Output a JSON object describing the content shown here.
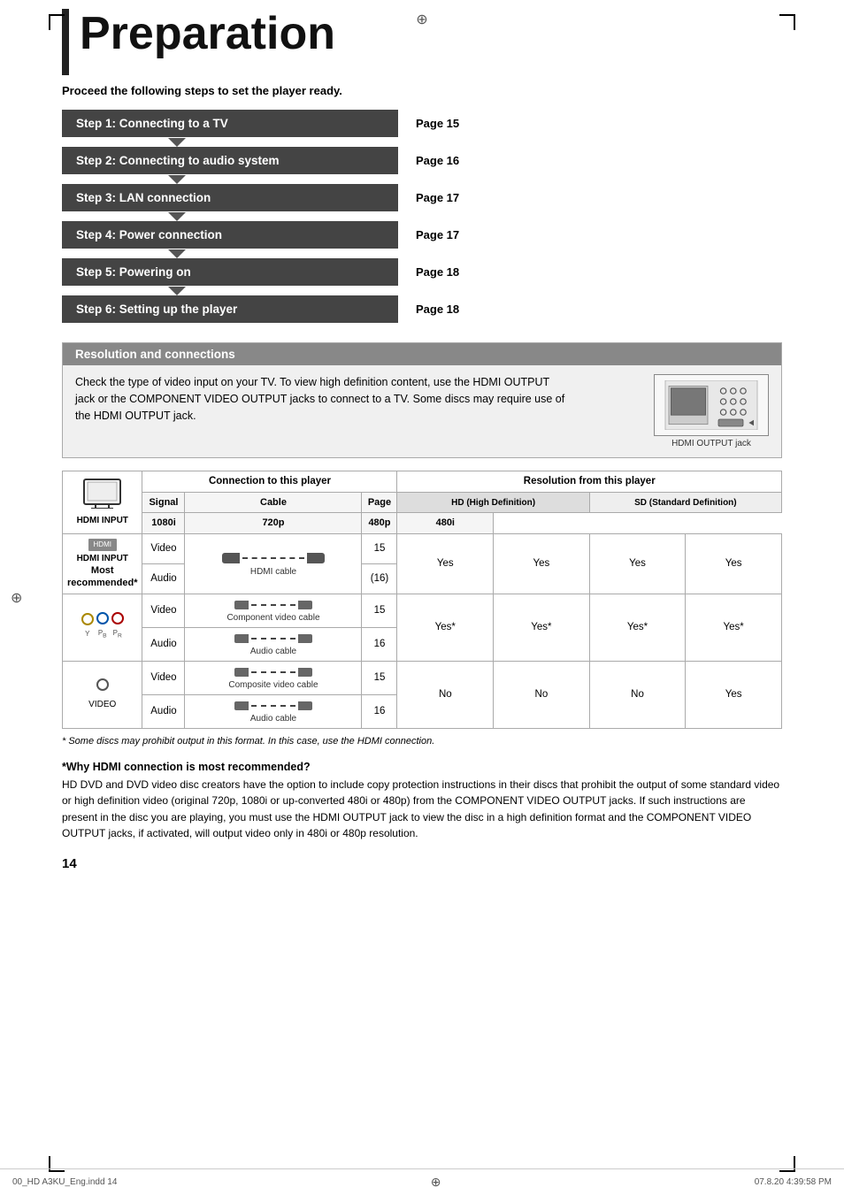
{
  "page": {
    "title": "Preparation",
    "subtitle": "Proceed the following steps to set the player ready.",
    "center_symbol": "⊕",
    "page_number": "14",
    "bottom_left": "00_HD A3KU_Eng.indd  14",
    "bottom_right": "07.8.20  4:39:58 PM"
  },
  "steps": [
    {
      "label": "Step 1: Connecting to a TV",
      "page": "Page 15",
      "has_arrow": true
    },
    {
      "label": "Step 2: Connecting to audio system",
      "page": "Page 16",
      "has_arrow": true
    },
    {
      "label": "Step 3: LAN connection",
      "page": "Page 17",
      "has_arrow": true
    },
    {
      "label": "Step 4: Power connection",
      "page": "Page 17",
      "has_arrow": true
    },
    {
      "label": "Step 5: Powering on",
      "page": "Page 18",
      "has_arrow": true
    },
    {
      "label": "Step 6: Setting up the player",
      "page": "Page 18",
      "has_arrow": false
    }
  ],
  "resolution_section": {
    "header": "Resolution and connections",
    "text": "Check the type of video input on your TV. To view high definition content, use the HDMI OUTPUT jack or the COMPONENT VIDEO OUTPUT jacks to connect to a TV. Some discs may require use of the HDMI OUTPUT jack.",
    "hdmi_label": "HDMI OUTPUT jack"
  },
  "table": {
    "connection_header": "Connection to this player",
    "resolution_header": "Resolution from this player",
    "hd_label": "HD (High Definition)",
    "sd_label": "SD (Standard Definition)",
    "cols": [
      "1080i",
      "720p",
      "480p",
      "480i"
    ],
    "col_signal": "Signal",
    "col_cable": "Cable",
    "col_page": "Page",
    "rows": [
      {
        "tv_type": "HDMI INPUT",
        "tv_note": "Most recommended*",
        "signal_rows": [
          "Video",
          "Audio"
        ],
        "cable_label": "HDMI cable",
        "page": [
          "15",
          "(16)"
        ],
        "values": [
          "Yes",
          "Yes",
          "Yes",
          "Yes"
        ]
      },
      {
        "tv_type": "Y PB PR",
        "tv_note": "",
        "signal_rows": [
          "Video",
          "Audio"
        ],
        "cable_label_video": "Component video cable",
        "cable_label_audio": "Audio cable",
        "page_video": "15",
        "page_audio": "16",
        "values": [
          "Yes*",
          "Yes*",
          "Yes*",
          "Yes*"
        ]
      },
      {
        "tv_type": "VIDEO",
        "tv_note": "",
        "signal_rows": [
          "Video",
          "Audio"
        ],
        "cable_label_video": "Composite video cable",
        "cable_label_audio": "Audio cable",
        "page_video": "15",
        "page_audio": "16",
        "values": [
          "No",
          "No",
          "No",
          "Yes"
        ]
      }
    ]
  },
  "footnote": "* Some discs may prohibit output in this format. In this case, use the HDMI connection.",
  "why_hdmi": {
    "title": "*Why HDMI connection is most recommended?",
    "text": "HD DVD and DVD video disc creators have the option to include copy protection instructions in their discs that prohibit the output of some standard video or high definition video (original 720p, 1080i or up-converted 480i or 480p) from the COMPONENT VIDEO OUTPUT jacks. If such instructions are present in the disc you are playing, you must use the HDMI OUTPUT jack to view the disc in a high definition format and the COMPONENT VIDEO OUTPUT jacks, if activated, will output video only in 480i or 480p resolution."
  }
}
